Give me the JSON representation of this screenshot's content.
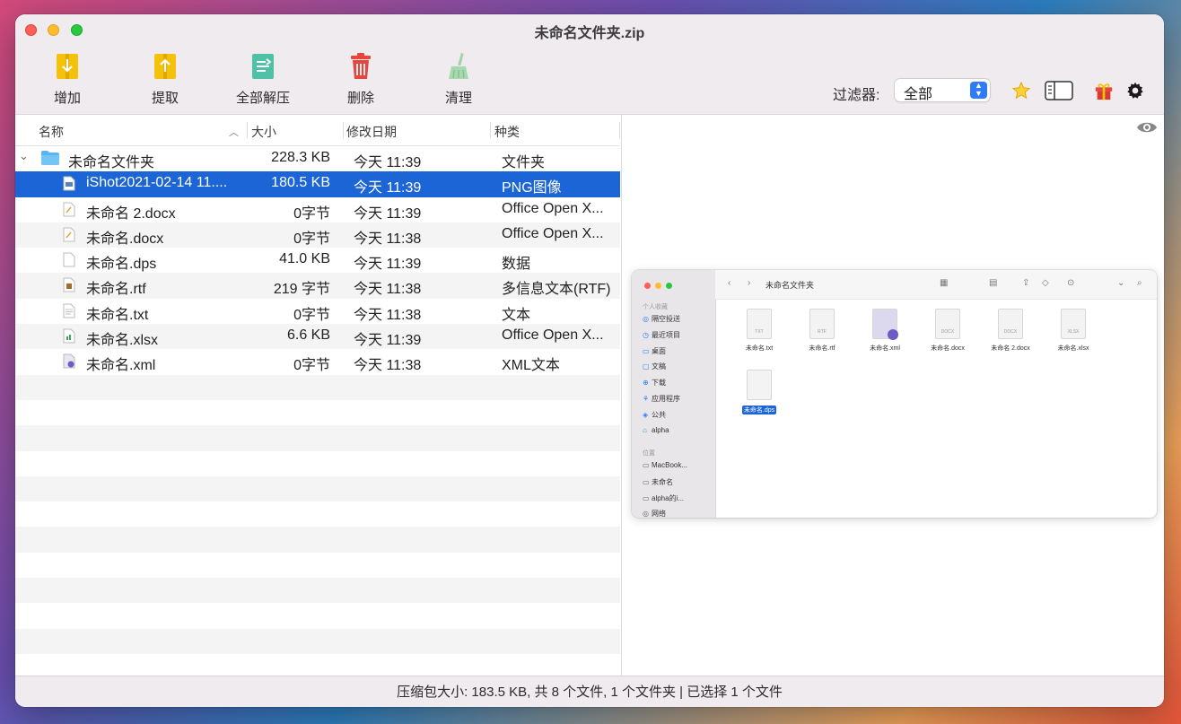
{
  "window": {
    "title": "未命名文件夹.zip"
  },
  "toolbar": {
    "add": "增加",
    "extract": "提取",
    "extract_all": "全部解压",
    "delete": "删除",
    "clean": "清理",
    "filter_label": "过滤器:",
    "filter_value": "全部"
  },
  "columns": {
    "name": "名称",
    "size": "大小",
    "date": "修改日期",
    "kind": "种类"
  },
  "rows": [
    {
      "name": "未命名文件夹",
      "size": "228.3 KB",
      "date": "今天 11:39",
      "kind": "文件夹",
      "icon": "folder-icon"
    },
    {
      "name": "iShot2021-02-14 11....",
      "size": "180.5 KB",
      "date": "今天 11:39",
      "kind": "PNG图像",
      "icon": "image-file-icon",
      "selected": true
    },
    {
      "name": "未命名 2.docx",
      "size": "0字节",
      "date": "今天 11:39",
      "kind": "Office Open X...",
      "icon": "docx-file-icon"
    },
    {
      "name": "未命名.docx",
      "size": "0字节",
      "date": "今天 11:38",
      "kind": "Office Open X...",
      "icon": "docx-file-icon"
    },
    {
      "name": "未命名.dps",
      "size": "41.0 KB",
      "date": "今天 11:39",
      "kind": "数据",
      "icon": "blank-file-icon"
    },
    {
      "name": "未命名.rtf",
      "size": "219 字节",
      "date": "今天 11:38",
      "kind": "多信息文本(RTF)",
      "icon": "rtf-file-icon"
    },
    {
      "name": "未命名.txt",
      "size": "0字节",
      "date": "今天 11:38",
      "kind": "文本",
      "icon": "txt-file-icon"
    },
    {
      "name": "未命名.xlsx",
      "size": "6.6 KB",
      "date": "今天 11:39",
      "kind": "Office Open X...",
      "icon": "xlsx-file-icon"
    },
    {
      "name": "未命名.xml",
      "size": "0字节",
      "date": "今天 11:38",
      "kind": "XML文本",
      "icon": "xml-file-icon"
    }
  ],
  "status": {
    "text": "压缩包大小: 183.5 KB, 共 8 个文件, 1 个文件夹 | 已选择 1 个文件"
  },
  "preview": {
    "finder_title": "未命名文件夹",
    "sidebar_section1": "个人收藏",
    "sidebar_section2": "位置",
    "sidebar": [
      "隔空投送",
      "最近项目",
      "桌面",
      "文稿",
      "下载",
      "应用程序",
      "公共",
      "alpha"
    ],
    "locations": [
      "MacBook...",
      "未命名",
      "alpha的i...",
      "网络"
    ],
    "files": [
      {
        "name": "未命名.txt",
        "tag": "TXT"
      },
      {
        "name": "未命名.rtf",
        "tag": "RTF"
      },
      {
        "name": "未命名.xml",
        "tag": ""
      },
      {
        "name": "未命名.docx",
        "tag": "DOCX"
      },
      {
        "name": "未命名 2.docx",
        "tag": "DOCX"
      },
      {
        "name": "未命名.xlsx",
        "tag": "XLSX"
      },
      {
        "name": "未命名.dps",
        "tag": ""
      }
    ]
  },
  "colors": {
    "selection": "#1c65d6",
    "accent": "#2f7cf6"
  }
}
